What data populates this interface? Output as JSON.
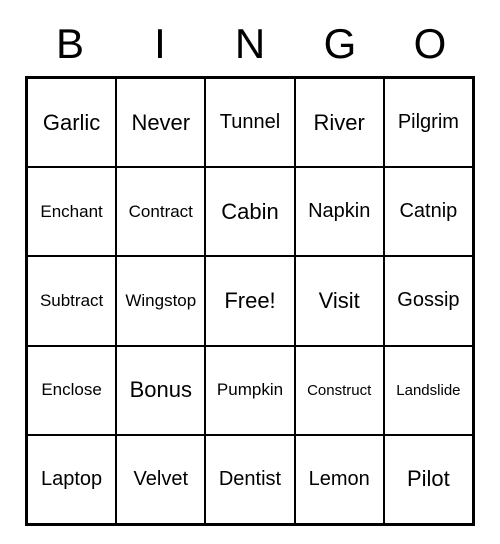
{
  "header": [
    "B",
    "I",
    "N",
    "G",
    "O"
  ],
  "grid": [
    [
      {
        "text": "Garlic",
        "size": "lg"
      },
      {
        "text": "Never",
        "size": "lg"
      },
      {
        "text": "Tunnel",
        "size": "md"
      },
      {
        "text": "River",
        "size": "lg"
      },
      {
        "text": "Pilgrim",
        "size": "md"
      }
    ],
    [
      {
        "text": "Enchant",
        "size": "sm"
      },
      {
        "text": "Contract",
        "size": "sm"
      },
      {
        "text": "Cabin",
        "size": "lg"
      },
      {
        "text": "Napkin",
        "size": "md"
      },
      {
        "text": "Catnip",
        "size": "md"
      }
    ],
    [
      {
        "text": "Subtract",
        "size": "sm"
      },
      {
        "text": "Wingstop",
        "size": "sm"
      },
      {
        "text": "Free!",
        "size": "lg"
      },
      {
        "text": "Visit",
        "size": "lg"
      },
      {
        "text": "Gossip",
        "size": "md"
      }
    ],
    [
      {
        "text": "Enclose",
        "size": "sm"
      },
      {
        "text": "Bonus",
        "size": "lg"
      },
      {
        "text": "Pumpkin",
        "size": "sm"
      },
      {
        "text": "Construct",
        "size": "xs"
      },
      {
        "text": "Landslide",
        "size": "xs"
      }
    ],
    [
      {
        "text": "Laptop",
        "size": "md"
      },
      {
        "text": "Velvet",
        "size": "md"
      },
      {
        "text": "Dentist",
        "size": "md"
      },
      {
        "text": "Lemon",
        "size": "md"
      },
      {
        "text": "Pilot",
        "size": "lg"
      }
    ]
  ]
}
